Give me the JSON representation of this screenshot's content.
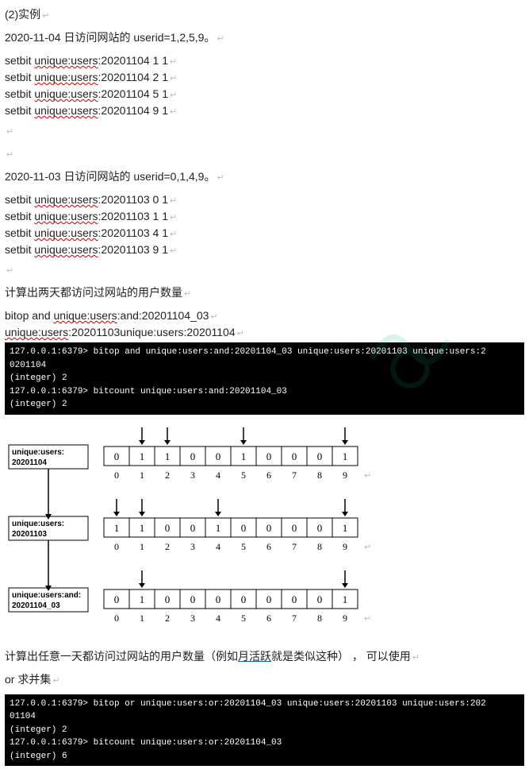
{
  "heading": "(2)实例",
  "p1": "2020-11-04 日访问网站的 userid=1,2,5,9。",
  "cmd1": [
    {
      "pre": "setbit ",
      "key": "unique:users",
      "rest": ":20201104 1 1"
    },
    {
      "pre": "setbit ",
      "key": "unique:users",
      "rest": ":20201104 2 1"
    },
    {
      "pre": "setbit ",
      "key": "unique:users",
      "rest": ":20201104 5 1"
    },
    {
      "pre": "setbit ",
      "key": "unique:users",
      "rest": ":20201104 9 1"
    }
  ],
  "p2": "2020-11-03 日访问网站的 userid=0,1,4,9。",
  "cmd2": [
    {
      "pre": "setbit ",
      "key": "unique:users",
      "rest": ":20201103 0 1"
    },
    {
      "pre": "setbit ",
      "key": "unique:users",
      "rest": ":20201103 1 1"
    },
    {
      "pre": "setbit ",
      "key": "unique:users",
      "rest": ":20201103 4 1"
    },
    {
      "pre": "setbit ",
      "key": "unique:users",
      "rest": ":20201103 9 1"
    }
  ],
  "p3": "计算出两天都访问过网站的用户数量",
  "bitop_and_a": "bitop and ",
  "bitop_and_b": "unique:users",
  "bitop_and_c": ":and:20201104_03",
  "bitop_and_d": " unique:users",
  "bitop_and_e": ":20201103unique:users:20201104",
  "terminal1": [
    "127.0.0.1:6379> bitop and unique:users:and:20201104_03 unique:users:20201103 unique:users:2",
    "0201104",
    "(integer) 2",
    "127.0.0.1:6379> bitcount unique:users:and:20201104_03",
    "(integer) 2"
  ],
  "p4a": "计算出任意一天都访问过网站的用户数量（例如",
  "p4b": "月活跃",
  "p4c": "就是类似这种）  ，   可以使用",
  "p5": "or 求并集",
  "terminal2": [
    "127.0.0.1:6379> bitop or unique:users:or:20201104_03 unique:users:20201103 unique:users:202",
    "01104",
    "(integer) 2",
    "127.0.0.1:6379> bitcount unique:users:or:20201104_03",
    "(integer) 6"
  ],
  "diagram": {
    "labels": [
      "unique:users:20201104",
      "unique:users:20201103",
      "unique:users:and:20201104_03"
    ],
    "rows": [
      {
        "bits": [
          0,
          1,
          1,
          0,
          0,
          1,
          0,
          0,
          0,
          1
        ],
        "arrows": [
          1,
          2,
          5,
          9
        ]
      },
      {
        "bits": [
          1,
          1,
          0,
          0,
          1,
          0,
          0,
          0,
          0,
          1
        ],
        "arrows": [
          0,
          1,
          4,
          9
        ]
      },
      {
        "bits": [
          0,
          1,
          0,
          0,
          0,
          0,
          0,
          0,
          0,
          1
        ],
        "arrows": [
          1,
          9
        ]
      }
    ],
    "indices": [
      0,
      1,
      2,
      3,
      4,
      5,
      6,
      7,
      8,
      9
    ]
  }
}
